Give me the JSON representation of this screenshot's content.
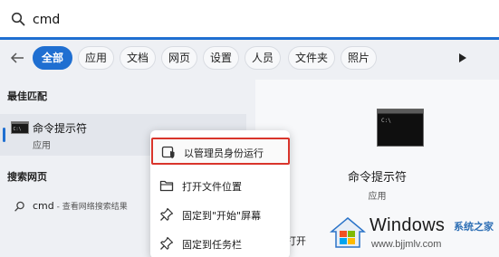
{
  "search": {
    "value": "cmd"
  },
  "filters": [
    "全部",
    "应用",
    "文档",
    "网页",
    "设置",
    "人员",
    "文件夹",
    "照片"
  ],
  "left": {
    "best_match_title": "最佳匹配",
    "best_match": {
      "title": "命令提示符",
      "subtitle": "应用"
    },
    "web_title": "搜索网页",
    "web_query": "cmd",
    "web_hint": " - 查看网络搜索结果"
  },
  "right": {
    "title": "命令提示符",
    "subtitle": "应用",
    "open_label": "打开"
  },
  "context_menu": [
    {
      "label": "以管理员身份运行",
      "icon": "admin-shield-icon"
    },
    {
      "label": "打开文件位置",
      "icon": "folder-icon"
    },
    {
      "label": "固定到\"开始\"屏幕",
      "icon": "pin-icon"
    },
    {
      "label": "固定到任务栏",
      "icon": "pin-icon"
    }
  ],
  "watermark": {
    "brand": "Windows",
    "cn": "系统之家",
    "url": "www.bjjmlv.com"
  },
  "colors": {
    "accent": "#1f6fd1",
    "highlight_border": "#d9342b"
  }
}
